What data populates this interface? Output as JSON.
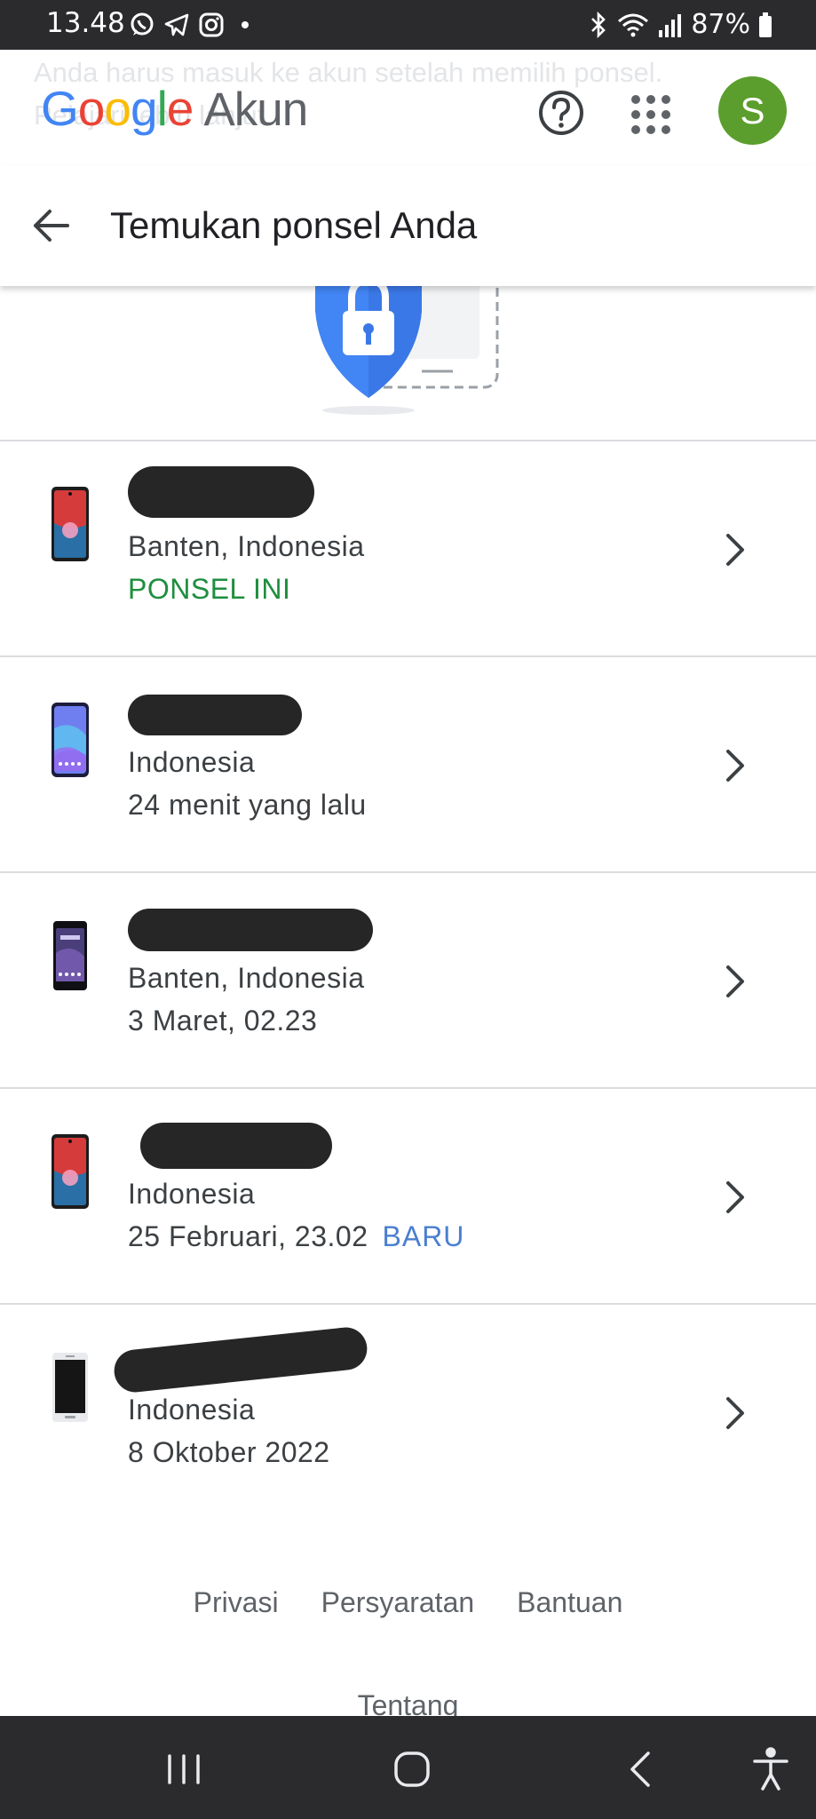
{
  "status_bar": {
    "time": "13.48",
    "battery": "87%",
    "left_icons": [
      "whatsapp-icon",
      "telegram-icon",
      "instagram-icon",
      "dot-icon"
    ],
    "right_icons": [
      "bluetooth-icon",
      "wifi-icon",
      "signal-icon",
      "battery-icon"
    ]
  },
  "header": {
    "logo_letters": [
      "G",
      "o",
      "o",
      "g",
      "l",
      "e"
    ],
    "product": "Akun",
    "background_text": "Anda harus masuk ke akun setelah memilih ponsel. Pelajari lebih lanjut",
    "avatar_initial": "S",
    "avatar_color": "#5b9e2d"
  },
  "title_bar": {
    "title": "Temukan ponsel Anda"
  },
  "devices": [
    {
      "location": "Banten, Indonesia",
      "status": "PONSEL INI",
      "status_color": "#1e8e3e"
    },
    {
      "location": "Indonesia",
      "status": "24 menit yang lalu"
    },
    {
      "location": "Banten, Indonesia",
      "status": "3 Maret, 02.23"
    },
    {
      "location": "Indonesia",
      "status": "25 Februari, 23.02",
      "badge": "BARU",
      "badge_color": "#4a7fd1"
    },
    {
      "location": "Indonesia",
      "status": "8 Oktober 2022"
    }
  ],
  "footer": {
    "links": [
      "Privasi",
      "Persyaratan",
      "Bantuan"
    ],
    "about": "Tentang"
  },
  "nav_bar": {
    "buttons": [
      "recent-apps-icon",
      "home-icon",
      "back-icon",
      "accessibility-icon"
    ]
  }
}
